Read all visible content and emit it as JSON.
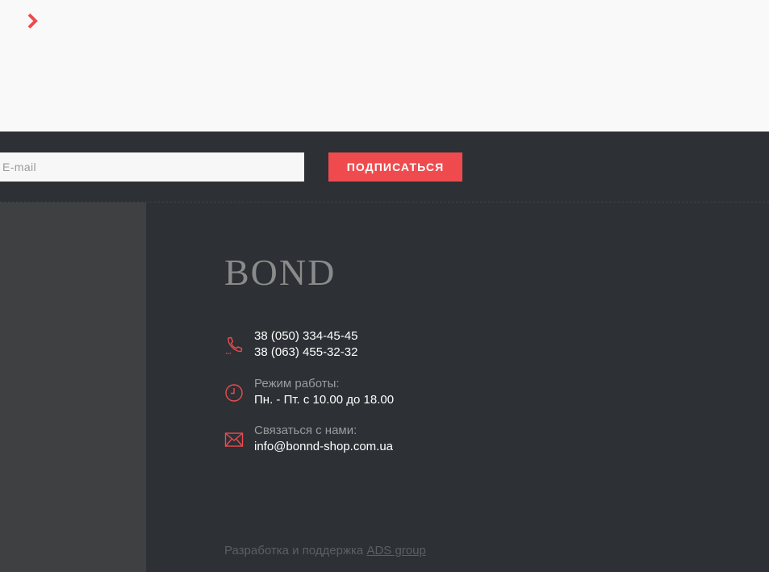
{
  "subscribe": {
    "email_placeholder": "E-mail",
    "button_label": "ПОДПИСАТЬСЯ"
  },
  "footer": {
    "logo_text": "BOND",
    "phone": {
      "line1": "38 (050) 334-45-45",
      "line2": "38 (063) 455-32-32"
    },
    "hours": {
      "label": "Режим работы:",
      "value": "Пн. - Пт. с 10.00 до 18.00"
    },
    "contact": {
      "label": "Связаться с нами:",
      "email": "info@bonnd-shop.com.ua"
    },
    "credit": {
      "text": "Разработка и поддержка",
      "link_label": "ADS group"
    }
  },
  "icons": {
    "chevron": "chevron-right-icon",
    "phone": "phone-icon",
    "clock": "clock-icon",
    "mail": "mail-icon"
  },
  "colors": {
    "accent": "#ef4b4f",
    "footer_bg": "#2d3034",
    "side_panel_bg": "#3f4041",
    "top_bg": "#f9f9f9"
  }
}
